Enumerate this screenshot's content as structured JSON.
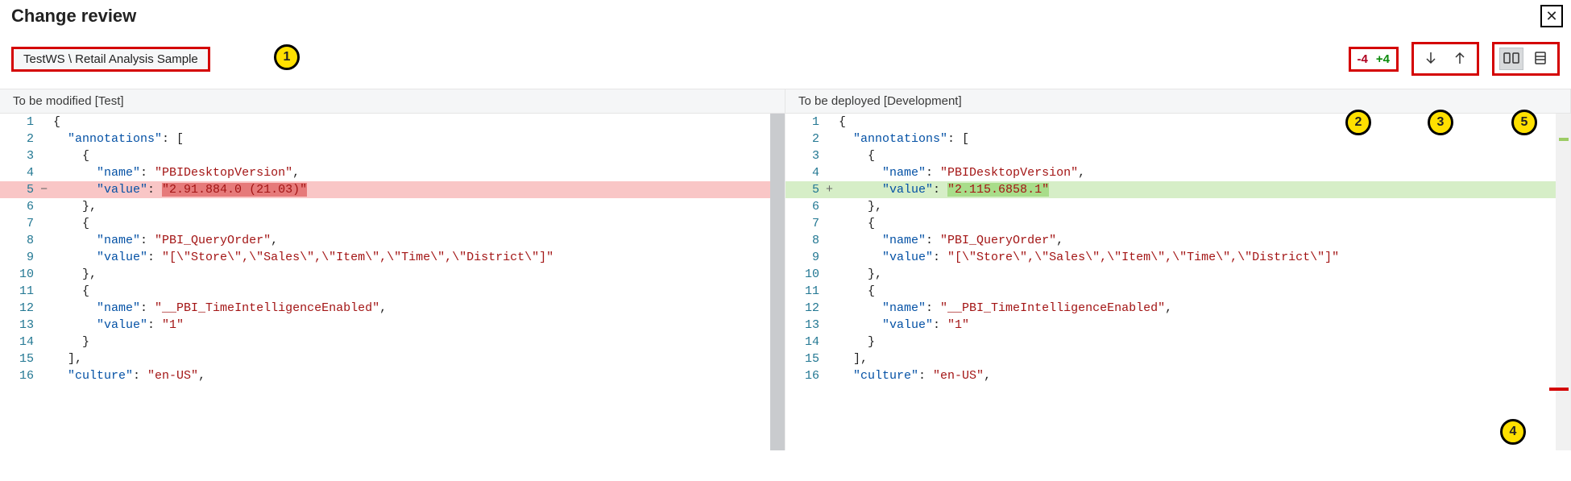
{
  "title": "Change review",
  "close_glyph": "✕",
  "file_path": "TestWS \\ Retail Analysis Sample",
  "diff_counts": {
    "removed": "-4",
    "added": "+4"
  },
  "callouts": {
    "c1": "1",
    "c2": "2",
    "c3": "3",
    "c4": "4",
    "c5": "5"
  },
  "left_header": "To be modified [Test]",
  "right_header": "To be deployed [Development]",
  "code": {
    "line1": "{",
    "line2_key": "\"annotations\"",
    "line2_rest": ": [",
    "line3": "{",
    "line4_name": "\"name\"",
    "line4_val": "\"PBIDesktopVersion\"",
    "line5_key": "\"value\"",
    "line5_left_val": "\"2.91.884.0 (21.03)\"",
    "line5_right_val": "\"2.115.6858.1\"",
    "line6": "},",
    "line7": "{",
    "line8_name": "\"name\"",
    "line8_val": "\"PBI_QueryOrder\"",
    "line9_key": "\"value\"",
    "line9_val": "\"[\\\"Store\\\",\\\"Sales\\\",\\\"Item\\\",\\\"Time\\\",\\\"District\\\"]\"",
    "line10": "},",
    "line11": "{",
    "line12_name": "\"name\"",
    "line12_val": "\"__PBI_TimeIntelligenceEnabled\"",
    "line13_key": "\"value\"",
    "line13_val": "\"1\"",
    "line14": "}",
    "line15": "],",
    "line16_key": "\"culture\"",
    "line16_val": "\"en-US\""
  },
  "gutters": {
    "l1": "1",
    "l2": "2",
    "l3": "3",
    "l4": "4",
    "l5": "5",
    "l6": "6",
    "l7": "7",
    "l8": "8",
    "l9": "9",
    "l10": "10",
    "l11": "11",
    "l12": "12",
    "l13": "13",
    "l14": "14",
    "l15": "15",
    "l16": "16"
  },
  "markers": {
    "minus": "−",
    "plus": "+"
  }
}
